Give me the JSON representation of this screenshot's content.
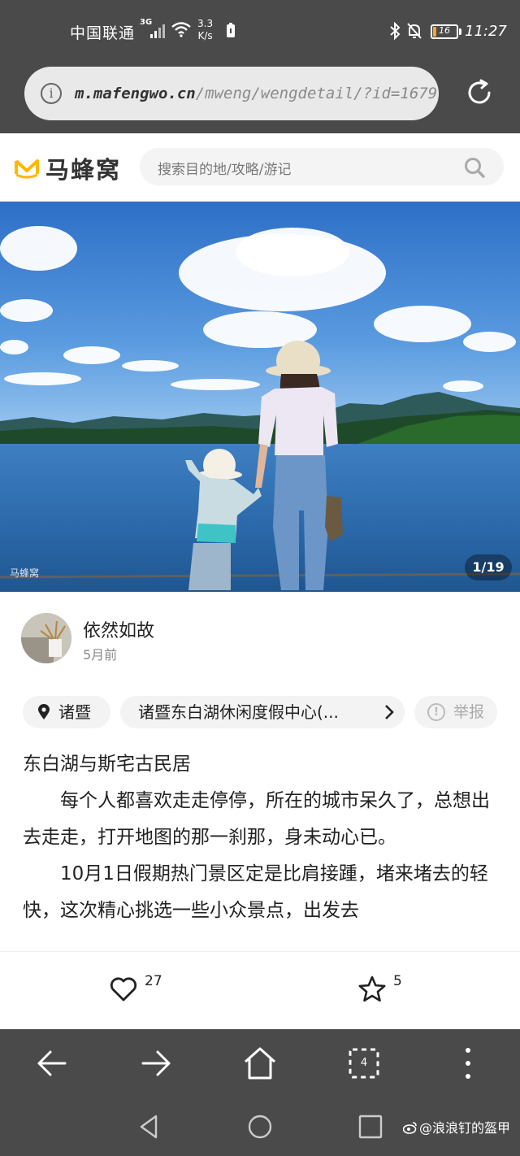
{
  "status_bar": {
    "carrier": "中国联通",
    "network_type": "3G",
    "speed_value": "3.3",
    "speed_unit": "K/s",
    "battery": "16",
    "battery_level": 0.16,
    "time": "11:27",
    "icons": [
      "signal-icon",
      "wifi-icon",
      "clipboard-icon",
      "bluetooth-icon",
      "mute-icon",
      "battery-icon"
    ]
  },
  "browser": {
    "url_domain": "m.mafengwo.cn",
    "url_path": "/mweng/wengdetail/?id=1679",
    "icons": [
      "info-icon",
      "reload-icon"
    ]
  },
  "site_header": {
    "logo_text": "马蜂窝",
    "search_placeholder": "搜索目的地/攻略/游记",
    "brand_color": "#ffb800"
  },
  "hero": {
    "watermark": "马蜂窝",
    "counter": "1/19"
  },
  "author": {
    "name": "依然如故",
    "time": "5月前"
  },
  "tags": {
    "location": "诸暨",
    "poi": "诸暨东白湖休闲度假中心(...",
    "report": "举报"
  },
  "article": {
    "title": "东白湖与斯宅古民居",
    "paragraphs": [
      "每个人都喜欢走走停停，所在的城市呆久了，总想出去走走，打开地图的那一刹那，身未动心已。",
      "10月1日假期热门景区定是比肩接踵，堵来堵去的轻快，这次精心挑选一些小众景点，出发去"
    ]
  },
  "actions": {
    "likes": "27",
    "favorites": "5"
  },
  "browser_nav": {
    "tab_count": "4"
  },
  "watermark": {
    "text": "@浪浪钉的盔甲"
  }
}
